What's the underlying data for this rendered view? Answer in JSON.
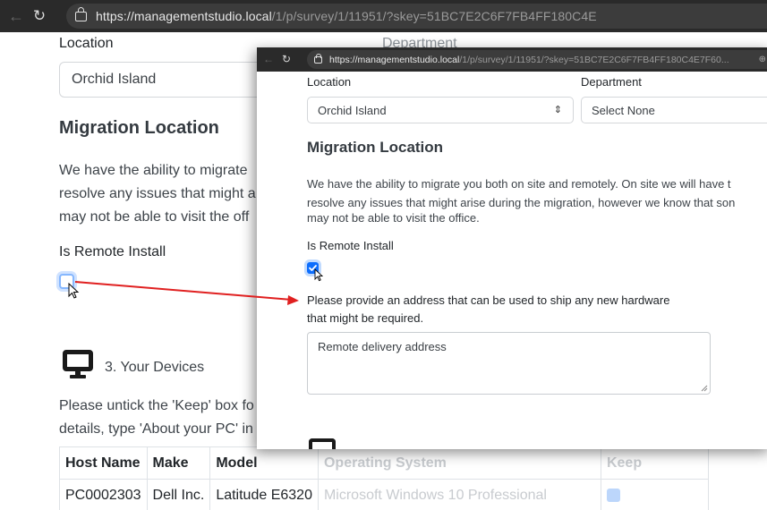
{
  "browser": {
    "url_main": "https://managementstudio.local",
    "url_rest": "/1/p/survey/1/11951/?skey=51BC7E2C6F7FB4FF180C4E7F60..."
  },
  "form": {
    "location_label": "Location",
    "location_value": "Orchid Island",
    "department_label": "Department",
    "department_value": "Select None",
    "migration_heading": "Migration Location",
    "migration_text_line1": "We have the ability to migrate you both on site and remotely. On site we will have t",
    "migration_text_line2": "resolve any issues that might arise during the migration, however we know that son",
    "migration_text_line3": "may not be able to visit the office.",
    "remote_install_label": "Is Remote Install",
    "remote_install_checked": true,
    "address_prompt_line1": "Please provide an address that can be used to ship any new hardware",
    "address_prompt_line2": "that might be required.",
    "address_placeholder": "Remote delivery address"
  },
  "background": {
    "location_label": "Location",
    "department_label": "Department",
    "location_value": "Orchid Island",
    "migration_heading": "Migration Location",
    "text_line1": "We have the ability to migrate",
    "text_line2": "resolve any issues that might a",
    "text_line3": "may not be able to visit the off",
    "remote_install_label": "Is Remote Install",
    "devices_heading": "3. Your Devices",
    "devices_text_line1": "Please untick the 'Keep' box fo",
    "devices_text_line2": "details, type 'About your PC' in",
    "table": {
      "headers": [
        "Host Name",
        "Make",
        "Model",
        "Operating System",
        "Keep"
      ],
      "rows": [
        [
          "PC0002303",
          "Dell Inc.",
          "Latitude E6320",
          "Microsoft Windows 10 Professional"
        ]
      ]
    }
  },
  "colors": {
    "arrow": "#e02020",
    "checkbox_accent": "#0d6efd"
  }
}
